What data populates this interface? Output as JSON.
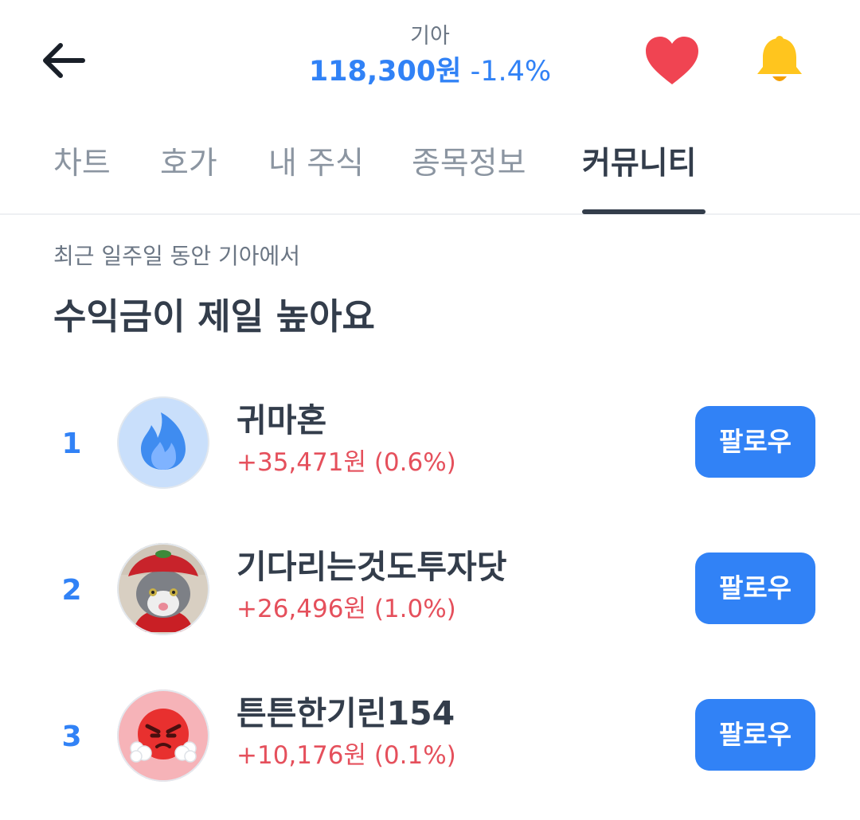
{
  "header": {
    "stock_name": "기아",
    "price": "118,300원",
    "change": "-1.4%",
    "back_icon": "arrow-left-icon",
    "favorite_icon": "heart-icon",
    "notification_icon": "bell-icon",
    "accent_color": "#3182f6",
    "heart_color": "#f04452",
    "bell_color": "#ffc51e"
  },
  "tabs": [
    {
      "label": "차트",
      "active": false
    },
    {
      "label": "호가",
      "active": false
    },
    {
      "label": "내 주식",
      "active": false
    },
    {
      "label": "종목정보",
      "active": false
    },
    {
      "label": "커뮤니티",
      "active": true
    }
  ],
  "section": {
    "subtitle": "최근 일주일 동안 기아에서",
    "title": "수익금이 제일 높아요"
  },
  "ranking": [
    {
      "rank": "1",
      "nickname": "귀마혼",
      "profit": "+35,471원 (0.6%)",
      "follow_label": "팔로우",
      "avatar": "blue-flame-avatar"
    },
    {
      "rank": "2",
      "nickname": "기다리는것도투자닷",
      "profit": "+26,496원 (1.0%)",
      "follow_label": "팔로우",
      "avatar": "cat-photo-avatar"
    },
    {
      "rank": "3",
      "nickname": "튼튼한기린154",
      "profit": "+10,176원 (0.1%)",
      "follow_label": "팔로우",
      "avatar": "angry-face-avatar"
    }
  ],
  "colors": {
    "profit": "#e5505c",
    "follow_button": "#3182f6",
    "text_primary": "#333d4b",
    "text_secondary": "#8b95a1"
  }
}
